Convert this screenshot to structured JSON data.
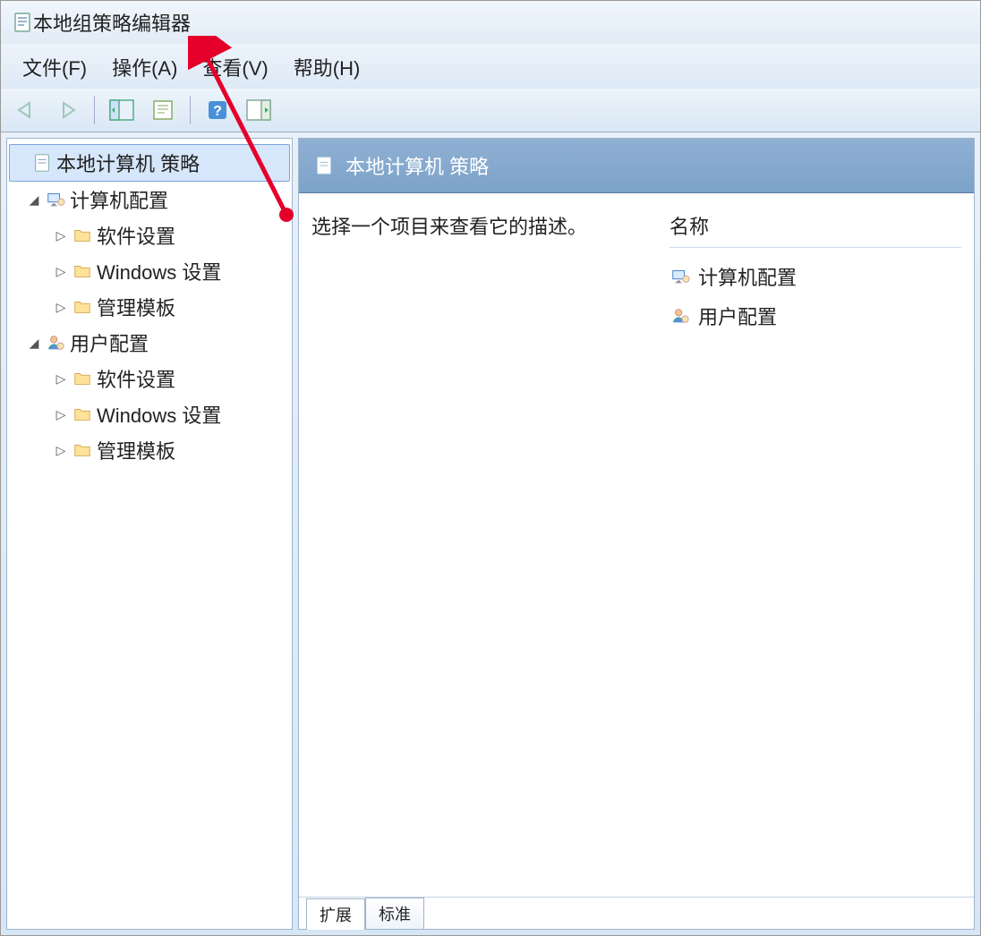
{
  "window": {
    "title": "本地组策略编辑器"
  },
  "menubar": {
    "file": "文件(F)",
    "action": "操作(A)",
    "view": "查看(V)",
    "help": "帮助(H)"
  },
  "tree": {
    "root": "本地计算机 策略",
    "computer_config": "计算机配置",
    "computer_children": [
      "软件设置",
      "Windows 设置",
      "管理模板"
    ],
    "user_config": "用户配置",
    "user_children": [
      "软件设置",
      "Windows 设置",
      "管理模板"
    ]
  },
  "details": {
    "header": "本地计算机 策略",
    "description": "选择一个项目来查看它的描述。",
    "column_name": "名称",
    "items": [
      "计算机配置",
      "用户配置"
    ]
  },
  "tabs": {
    "extended": "扩展",
    "standard": "标准"
  }
}
